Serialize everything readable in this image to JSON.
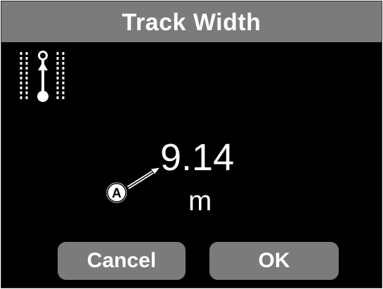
{
  "dialog": {
    "title": "Track Width"
  },
  "icon": {
    "name": "track-width-icon"
  },
  "value": {
    "number": "9.14",
    "unit": "m"
  },
  "callout": {
    "label": "A",
    "icon": "callout-arrow-icon"
  },
  "buttons": {
    "cancel_label": "Cancel",
    "ok_label": "OK"
  },
  "colors": {
    "background": "#000000",
    "bar": "#7b7b7b",
    "text": "#ffffff"
  }
}
